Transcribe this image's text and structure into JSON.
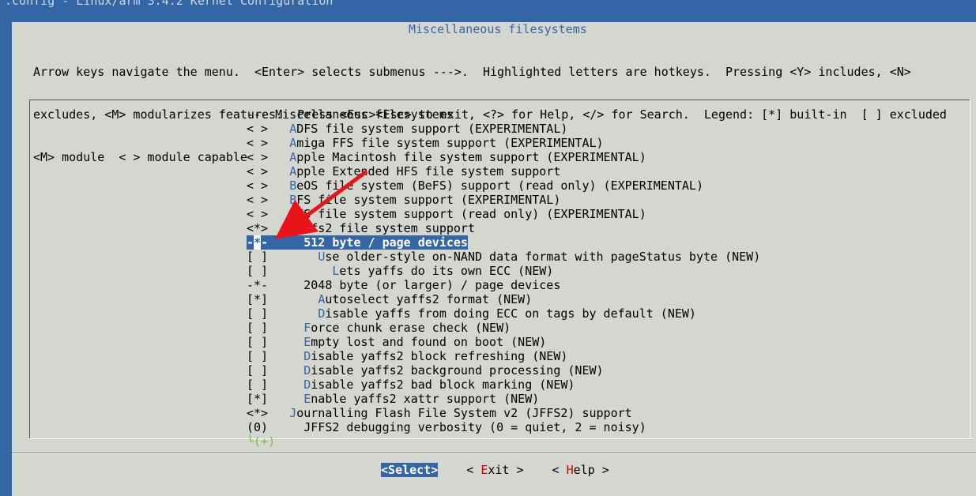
{
  "window": {
    "title": ".config - Linux/arm 3.4.2 Kernel Configuration"
  },
  "dialog": {
    "title": "Miscellaneous filesystems",
    "help_lines": [
      "Arrow keys navigate the menu.  <Enter> selects submenus --->.  Highlighted letters are hotkeys.  Pressing <Y> includes, <N>",
      "excludes, <M> modularizes features.  Press <Esc><Esc> to exit, <?> for Help, </> for Search.  Legend: [*] built-in  [ ] excluded",
      "<M> module  < > module capable"
    ]
  },
  "menu": [
    {
      "state": "---",
      "indent": " ",
      "hotkey": "",
      "rest": "Miscellaneous filesystems"
    },
    {
      "state": "< >",
      "indent": "   ",
      "hotkey": "A",
      "rest": "DFS file system support (EXPERIMENTAL)"
    },
    {
      "state": "< >",
      "indent": "   ",
      "hotkey": "A",
      "rest": "miga FFS file system support (EXPERIMENTAL)"
    },
    {
      "state": "< >",
      "indent": "   ",
      "hotkey": "A",
      "rest": "pple Macintosh file system support (EXPERIMENTAL)"
    },
    {
      "state": "< >",
      "indent": "   ",
      "hotkey": "A",
      "rest": "pple Extended HFS file system support"
    },
    {
      "state": "< >",
      "indent": "   ",
      "hotkey": "B",
      "rest": "eOS file system (BeFS) support (read only) (EXPERIMENTAL)"
    },
    {
      "state": "< >",
      "indent": "   ",
      "hotkey": "B",
      "rest": "FS file system support (EXPERIMENTAL)"
    },
    {
      "state": "< >",
      "indent": "   ",
      "hotkey": "E",
      "rest": "FS file system support (read only) (EXPERIMENTAL)"
    },
    {
      "state": "<*>",
      "indent": "   ",
      "hotkey": "y",
      "rest": "affs2 file system support"
    },
    {
      "state": "-*-",
      "indent": "     ",
      "hotkey": "",
      "rest": "512 byte / page devices",
      "selected": true
    },
    {
      "state": "[ ]",
      "indent": "       ",
      "hotkey": "U",
      "rest": "se older-style on-NAND data format with pageStatus byte (NEW)"
    },
    {
      "state": "[ ]",
      "indent": "         ",
      "hotkey": "L",
      "rest": "ets yaffs do its own ECC (NEW)"
    },
    {
      "state": "-*-",
      "indent": "     ",
      "hotkey": "",
      "rest": "2048 byte (or larger) / page devices"
    },
    {
      "state": "[*]",
      "indent": "       ",
      "hotkey": "A",
      "rest": "utoselect yaffs2 format (NEW)"
    },
    {
      "state": "[ ]",
      "indent": "       ",
      "hotkey": "D",
      "rest": "isable yaffs from doing ECC on tags by default (NEW)"
    },
    {
      "state": "[ ]",
      "indent": "     ",
      "hotkey": "F",
      "rest": "orce chunk erase check (NEW)"
    },
    {
      "state": "[ ]",
      "indent": "     ",
      "hotkey": "E",
      "rest": "mpty lost and found on boot (NEW)"
    },
    {
      "state": "[ ]",
      "indent": "     ",
      "hotkey": "D",
      "rest": "isable yaffs2 block refreshing (NEW)"
    },
    {
      "state": "[ ]",
      "indent": "     ",
      "hotkey": "D",
      "rest": "isable yaffs2 background processing (NEW)"
    },
    {
      "state": "[ ]",
      "indent": "     ",
      "hotkey": "D",
      "rest": "isable yaffs2 bad block marking (NEW)"
    },
    {
      "state": "[*]",
      "indent": "     ",
      "hotkey": "E",
      "rest": "nable yaffs2 xattr support (NEW)"
    },
    {
      "state": "<*>",
      "indent": "   ",
      "hotkey": "J",
      "rest": "ournalling Flash File System v2 (JFFS2) support"
    },
    {
      "state": "(0)",
      "indent": "     ",
      "hotkey": "",
      "rest": "JFFS2 debugging verbosity (0 = quiet, 2 = noisy)"
    }
  ],
  "more_indicator": "└(+)",
  "buttons": [
    {
      "prefix": "<",
      "hotkey": "S",
      "rest": "elect",
      "suffix": ">",
      "active": true
    },
    {
      "prefix": "< ",
      "hotkey": "E",
      "rest": "xit",
      "suffix": " >",
      "active": false
    },
    {
      "prefix": "< ",
      "hotkey": "H",
      "rest": "elp",
      "suffix": " >",
      "active": false
    }
  ],
  "colors": {
    "background": "#3465a4",
    "dialog": "#d3d7cf",
    "hotkey": "#3465a4",
    "arrow": "#e8141a"
  }
}
